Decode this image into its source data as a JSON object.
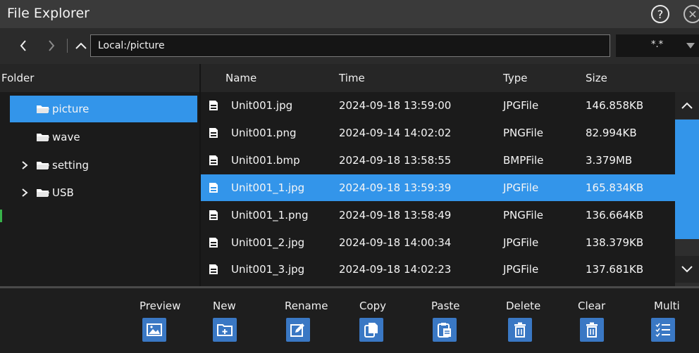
{
  "window": {
    "title": "File Explorer",
    "help_glyph": "?",
    "close_glyph": "✕"
  },
  "navbar": {
    "back_icon": "chevron-left-icon",
    "forward_icon": "chevron-right-icon",
    "up_icon": "chevron-up-icon",
    "path": "Local:/picture",
    "filter": "*.*"
  },
  "folders": {
    "header": "Folder",
    "items": [
      {
        "label": "picture",
        "expandable": false,
        "selected": true
      },
      {
        "label": "wave",
        "expandable": false,
        "selected": false
      },
      {
        "label": "setting",
        "expandable": true,
        "selected": false
      },
      {
        "label": "USB",
        "expandable": true,
        "selected": false
      }
    ]
  },
  "files": {
    "columns": {
      "name": "Name",
      "time": "Time",
      "type": "Type",
      "size": "Size"
    },
    "rows": [
      {
        "name": "Unit001.jpg",
        "time": "2024-09-18 13:59:00",
        "type": "JPGFile",
        "size": "146.858KB",
        "selected": false
      },
      {
        "name": "Unit001.png",
        "time": "2024-09-14 14:02:02",
        "type": "PNGFile",
        "size": "82.994KB",
        "selected": false
      },
      {
        "name": "Unit001.bmp",
        "time": "2024-09-18 13:58:55",
        "type": "BMPFile",
        "size": "3.379MB",
        "selected": false
      },
      {
        "name": "Unit001_1.jpg",
        "time": "2024-09-18 13:59:39",
        "type": "JPGFile",
        "size": "165.834KB",
        "selected": true
      },
      {
        "name": "Unit001_1.png",
        "time": "2024-09-18 13:58:49",
        "type": "PNGFile",
        "size": "136.664KB",
        "selected": false
      },
      {
        "name": "Unit001_2.jpg",
        "time": "2024-09-18 14:00:34",
        "type": "JPGFile",
        "size": "138.379KB",
        "selected": false
      },
      {
        "name": "Unit001_3.jpg",
        "time": "2024-09-18 14:02:23",
        "type": "JPGFile",
        "size": "137.681KB",
        "selected": false
      }
    ]
  },
  "toolbar": {
    "buttons": [
      {
        "label": "Preview",
        "icon": "image-icon"
      },
      {
        "label": "New",
        "icon": "new-folder-icon"
      },
      {
        "label": "Rename",
        "icon": "rename-icon"
      },
      {
        "label": "Copy",
        "icon": "copy-icon"
      },
      {
        "label": "Paste",
        "icon": "paste-icon"
      },
      {
        "label": "Delete",
        "icon": "trash-icon"
      },
      {
        "label": "Clear",
        "icon": "trash-icon"
      },
      {
        "label": "Multi",
        "icon": "checklist-icon"
      }
    ]
  },
  "colors": {
    "accent": "#3395ea",
    "toolbar_button": "#3a78c4",
    "background": "#1b1b1b",
    "titlebar": "#3a3a3a"
  }
}
